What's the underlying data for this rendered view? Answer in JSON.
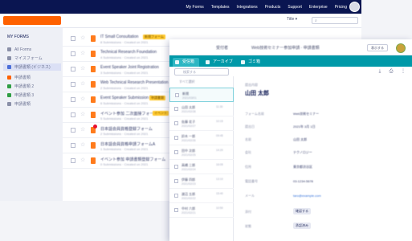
{
  "topnav": {
    "items": [
      "My Forms",
      "Templates",
      "Integrations",
      "Products",
      "Support",
      "Enterprise",
      "Pricing"
    ]
  },
  "toolbar": {
    "sort_label": "Title ▾",
    "search_placeholder": ""
  },
  "sidebar": {
    "title": "MY FORMS",
    "items": [
      {
        "label": "All Forms",
        "color": "#8a90a8"
      },
      {
        "label": "マイスフォーム",
        "color": "#8a90a8"
      },
      {
        "label": "申請書類 (ビジネス)",
        "color": "#4c6fd8"
      },
      {
        "label": "申請書類",
        "color": "#ff6100"
      },
      {
        "label": "申請書類 2",
        "color": "#2f9e44"
      },
      {
        "label": "申請書類 3",
        "color": "#2f9e44"
      },
      {
        "label": "申請書類",
        "color": "#8a90a8"
      }
    ]
  },
  "forms": [
    {
      "title": "IT Small Consultation",
      "sub": "8 Submissions · Created on 2021",
      "tag": "新規フォーム"
    },
    {
      "title": "Technical Research Foundation",
      "sub": "4 Submissions · Created on 2021",
      "tag": ""
    },
    {
      "title": "Event Speaker Joint Registration",
      "sub": "3 Submissions · Created on 2021",
      "tag": ""
    },
    {
      "title": "Web Technical Research Presentation",
      "sub": "2 Submissions · Created on 2021",
      "tag": ""
    },
    {
      "title": "Event Speaker Submission Form",
      "sub": "6 Submissions · Created on 2021",
      "tag": "申請書類"
    },
    {
      "title": "イベント参加 二次面接フォーム",
      "sub": "5 Submissions · Created on 2021",
      "tag": "イベント"
    },
    {
      "title": "日本語会員資格登録フォーム",
      "sub": "2 Submissions · Created on 2021",
      "tag": ""
    },
    {
      "title": "日本語会員資格申請フォームA",
      "sub": "1 Submissions · Created on 2021",
      "tag": ""
    },
    {
      "title": "イベント参加 申請書類登録フォーム",
      "sub": "0 Submissions · Created on 2021",
      "tag": ""
    }
  ],
  "panel": {
    "who": "受付者",
    "title": "Web技術セミナー参加申請 · 申請書類",
    "action": "表示する",
    "tabs": [
      "受信箱",
      "アーカイブ",
      "ゴミ箱"
    ],
    "search_placeholder": "検索する",
    "list_header": "すべて選択",
    "submissions": [
      {
        "name": "新規",
        "date": "2021/03/01",
        "time": "12:00"
      },
      {
        "name": "山田 太郎",
        "date": "2021/02/28",
        "time": "11:30"
      },
      {
        "name": "佐藤 花子",
        "date": "2021/02/27",
        "time": "10:15"
      },
      {
        "name": "鈴木 一郎",
        "date": "2021/02/26",
        "time": "09:45"
      },
      {
        "name": "田中 次郎",
        "date": "2021/02/25",
        "time": "14:20"
      },
      {
        "name": "高橋 三郎",
        "date": "2021/02/24",
        "time": "16:05"
      },
      {
        "name": "伊藤 四郎",
        "date": "2021/02/23",
        "time": "13:10"
      },
      {
        "name": "渡辺 五郎",
        "date": "2021/02/22",
        "time": "15:40"
      },
      {
        "name": "中村 六郎",
        "date": "2021/02/21",
        "time": "10:50"
      }
    ],
    "detail": {
      "heading": "提出内容",
      "name_big": "山田 太郎",
      "fields": [
        {
          "label": "フォーム名前",
          "value": "Web技術セミナー"
        },
        {
          "label": "提出日",
          "value": "2021年 3月 1日"
        },
        {
          "label": "名前",
          "value": "山田 太郎"
        },
        {
          "label": "会社",
          "value": "テクノロジー"
        },
        {
          "label": "住所",
          "value": "東京都渋谷区"
        },
        {
          "label": "電話番号",
          "value": "03-1234-5678"
        },
        {
          "label": "メール",
          "value": "taro@example.com"
        },
        {
          "label": "添付",
          "value": "確認する"
        },
        {
          "label": "状態",
          "value": "承認済み"
        }
      ]
    }
  }
}
